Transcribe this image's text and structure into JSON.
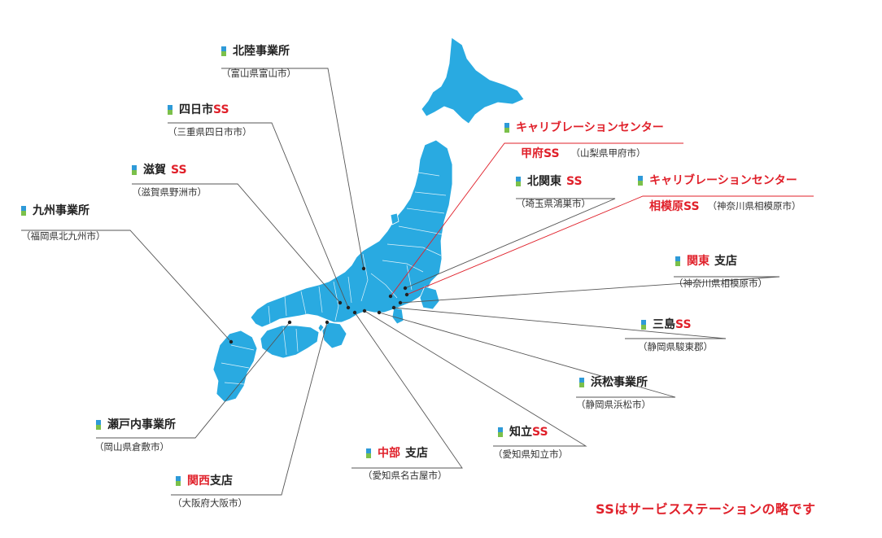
{
  "colors": {
    "land": "#29aae1",
    "accent": "#e0202a",
    "marker_top": "#2e9ad8",
    "marker_bottom": "#7bc04a"
  },
  "icons": {
    "label_marker": "blue-green-bar-icon"
  },
  "offices": {
    "hokuriku": {
      "name": "北陸事業所",
      "loc": "（富山県富山市）"
    },
    "yokkaichi": {
      "name": "四日市",
      "suffix": "SS",
      "loc": "（三重県四日市市）"
    },
    "shiga": {
      "name": "滋賀",
      "suffix": "SS",
      "loc": "（滋賀県野洲市）"
    },
    "kyushu": {
      "name": "九州事業所",
      "loc": "（福岡県北九州市）"
    },
    "career_kofu": {
      "title": "キャリブレーションセンター",
      "name": "甲府SS",
      "loc": "（山梨県甲府市）"
    },
    "kitakanto": {
      "name": "北関東",
      "suffix": "SS",
      "loc": "（埼玉県鴻巣市）"
    },
    "career_sagami": {
      "title": "キャリブレーションセンター",
      "name": "相模原SS",
      "loc": "（神奈川県相模原市）"
    },
    "kanto": {
      "name": "関東",
      "suffix": "支店",
      "loc": "（神奈川県相模原市）"
    },
    "mishima": {
      "name": "三島",
      "suffix": "SS",
      "loc": "（静岡県駿東郡）"
    },
    "hamamatsu": {
      "name": "浜松事業所",
      "loc": "（静岡県浜松市）"
    },
    "chiryu": {
      "name": "知立",
      "suffix": "SS",
      "loc": "（愛知県知立市）"
    },
    "chubu": {
      "name": "中部",
      "suffix": "支店",
      "loc": "（愛知県名古屋市）"
    },
    "kansai": {
      "name": "関西",
      "suffix": "支店",
      "loc": "（大阪府大阪市）"
    },
    "setouchi": {
      "name": "瀬戸内事業所",
      "loc": "（岡山県倉敷市）"
    }
  },
  "note": "SSはサービスステーションの略です"
}
